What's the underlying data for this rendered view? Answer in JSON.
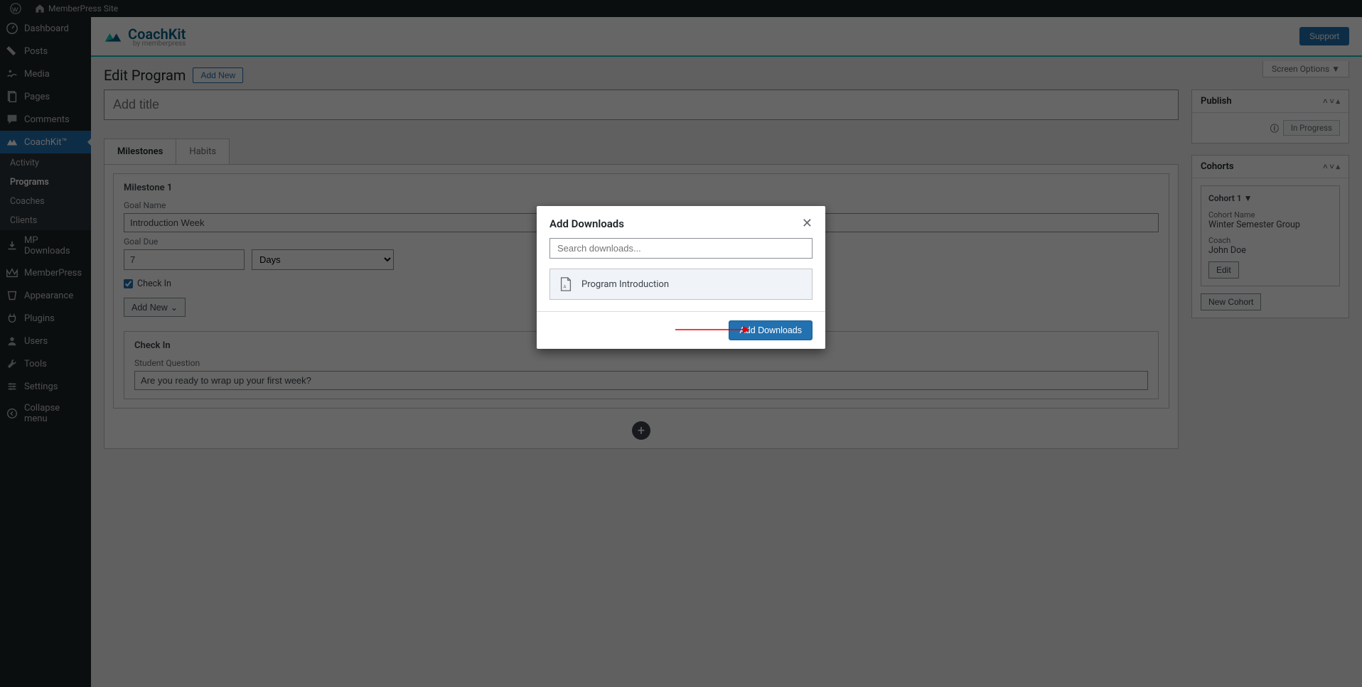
{
  "adminbar": {
    "site_name": "MemberPress Site"
  },
  "sidebar": {
    "items": [
      {
        "label": "Dashboard"
      },
      {
        "label": "Posts"
      },
      {
        "label": "Media"
      },
      {
        "label": "Pages"
      },
      {
        "label": "Comments"
      },
      {
        "label": "CoachKit™"
      },
      {
        "label": "MP Downloads"
      },
      {
        "label": "MemberPress"
      },
      {
        "label": "Appearance"
      },
      {
        "label": "Plugins"
      },
      {
        "label": "Users"
      },
      {
        "label": "Tools"
      },
      {
        "label": "Settings"
      },
      {
        "label": "Collapse menu"
      }
    ],
    "submenu": [
      {
        "label": "Activity"
      },
      {
        "label": "Programs"
      },
      {
        "label": "Coaches"
      },
      {
        "label": "Clients"
      }
    ]
  },
  "brand": {
    "name": "CoachKit",
    "byline": "by memberpress",
    "support": "Support"
  },
  "page": {
    "title": "Edit Program",
    "add_new": "Add New",
    "screen_options": "Screen Options ▼",
    "title_placeholder": "Add title"
  },
  "tabs": {
    "milestones": "Milestones",
    "habits": "Habits"
  },
  "milestone": {
    "heading": "Milestone 1",
    "goal_name_label": "Goal Name",
    "goal_name_value": "Introduction Week",
    "goal_due_label": "Goal Due",
    "goal_due_value": "7",
    "unit": "Days",
    "checkin_label": "Check In",
    "add_new": "Add New"
  },
  "checkin": {
    "heading": "Check In",
    "question_label": "Student Question",
    "question_value": "Are you ready to wrap up your first week?"
  },
  "publish": {
    "title": "Publish",
    "status": "In Progress"
  },
  "cohorts": {
    "title": "Cohorts",
    "cohort_label": "Cohort 1 ▼",
    "name_label": "Cohort Name",
    "name_value": "Winter Semester Group",
    "coach_label": "Coach",
    "coach_value": "John Doe",
    "edit": "Edit",
    "new_cohort": "New Cohort"
  },
  "modal": {
    "title": "Add Downloads",
    "search_placeholder": "Search downloads...",
    "item": "Program Introduction",
    "submit": "Add Downloads"
  }
}
